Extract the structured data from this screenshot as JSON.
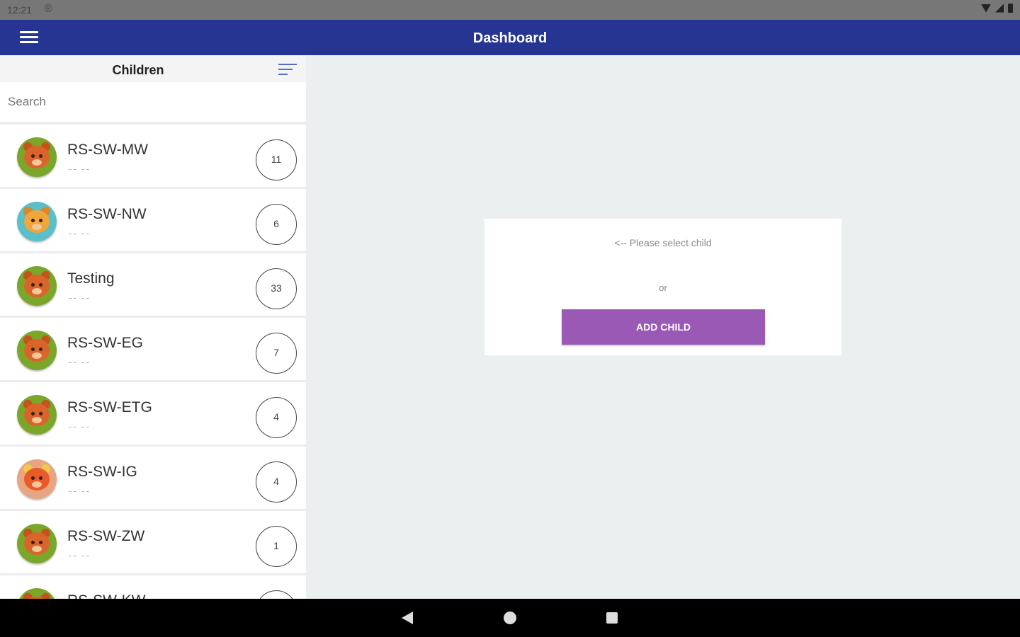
{
  "status_bar": {
    "time": "12:21",
    "sync_glyph": "®"
  },
  "app_bar": {
    "title": "Dashboard",
    "menu_icon": "hamburger-menu-icon"
  },
  "children_panel": {
    "title": "Children",
    "sort_icon": "sort-icon",
    "search": {
      "placeholder": "Search",
      "value": ""
    },
    "items": [
      {
        "name": "RS-SW-MW",
        "sub": "-- --",
        "count": "11",
        "avatar": "bear"
      },
      {
        "name": "RS-SW-NW",
        "sub": "-- --",
        "count": "6",
        "avatar": "owl"
      },
      {
        "name": "Testing",
        "sub": "-- --",
        "count": "33",
        "avatar": "bear"
      },
      {
        "name": "RS-SW-EG",
        "sub": "-- --",
        "count": "7",
        "avatar": "bear"
      },
      {
        "name": "RS-SW-ETG",
        "sub": "-- --",
        "count": "4",
        "avatar": "bear"
      },
      {
        "name": "RS-SW-IG",
        "sub": "-- --",
        "count": "4",
        "avatar": "fox"
      },
      {
        "name": "RS-SW-ZW",
        "sub": "-- --",
        "count": "1",
        "avatar": "bear"
      },
      {
        "name": "RS-SW-KW",
        "sub": "",
        "count": "",
        "avatar": "bear"
      }
    ]
  },
  "main": {
    "prompt": "<-- Please select child",
    "or": "or",
    "add_child_label": "ADD CHILD"
  },
  "colors": {
    "app_bar": "#273592",
    "add_button": "#9b59b6",
    "background": "#eceff0"
  },
  "nav_bar": {
    "back_icon": "back-triangle-icon",
    "home_icon": "home-circle-icon",
    "recents_icon": "recents-square-icon"
  }
}
